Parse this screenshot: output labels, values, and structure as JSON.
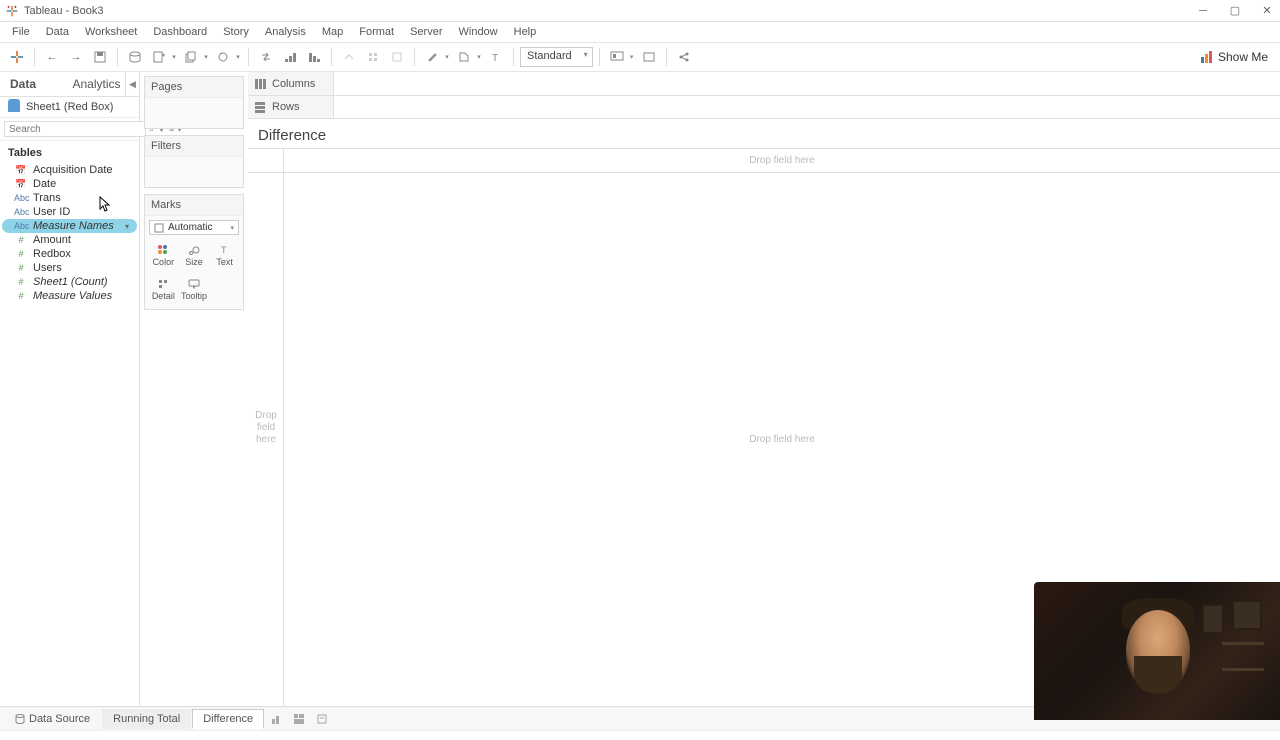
{
  "window": {
    "title": "Tableau - Book3"
  },
  "menu": [
    "File",
    "Data",
    "Worksheet",
    "Dashboard",
    "Story",
    "Analysis",
    "Map",
    "Format",
    "Server",
    "Window",
    "Help"
  ],
  "toolbar": {
    "fit": "Standard",
    "showme": "Show Me"
  },
  "dataPane": {
    "tabs": {
      "data": "Data",
      "analytics": "Analytics"
    },
    "datasource": "Sheet1 (Red Box)",
    "search_placeholder": "Search",
    "tables_header": "Tables",
    "fields": [
      {
        "icon": "📅",
        "type": "dim",
        "name": "Acquisition Date"
      },
      {
        "icon": "📅",
        "type": "dim",
        "name": "Date"
      },
      {
        "icon": "Abc",
        "type": "dim",
        "name": "Trans"
      },
      {
        "icon": "Abc",
        "type": "dim",
        "name": "User ID"
      },
      {
        "icon": "Abc",
        "type": "dim",
        "name": "Measure Names",
        "italic": true,
        "selected": true
      },
      {
        "icon": "#",
        "type": "meas",
        "name": "Amount"
      },
      {
        "icon": "#",
        "type": "meas",
        "name": "Redbox"
      },
      {
        "icon": "#",
        "type": "meas",
        "name": "Users"
      },
      {
        "icon": "#",
        "type": "meas",
        "name": "Sheet1 (Count)",
        "italic": true
      },
      {
        "icon": "#",
        "type": "meas",
        "name": "Measure Values",
        "italic": true
      }
    ]
  },
  "cards": {
    "pages": "Pages",
    "filters": "Filters",
    "marks": "Marks",
    "marksType": "Automatic",
    "markCells": [
      "Color",
      "Size",
      "Text",
      "Detail",
      "Tooltip"
    ]
  },
  "shelves": {
    "columns": "Columns",
    "rows": "Rows"
  },
  "sheet": {
    "title": "Difference",
    "dropColHint": "Drop field here",
    "dropRowHint": "Drop field here",
    "dropMainHint": "Drop field here"
  },
  "bottomTabs": {
    "datasource": "Data Source",
    "tabs": [
      "Running Total",
      "Difference"
    ],
    "active": "Difference"
  }
}
